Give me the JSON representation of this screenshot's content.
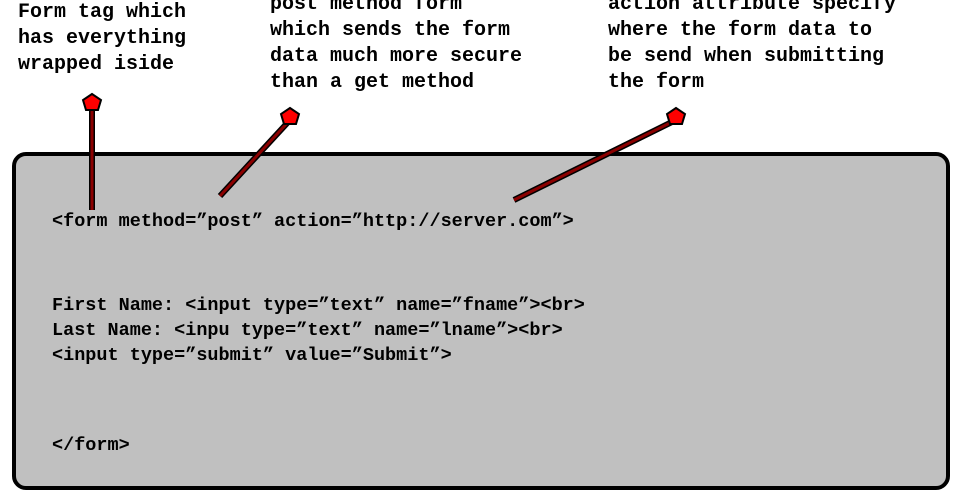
{
  "annotations": {
    "form_tag": "Form tag which\nhas everything\nwrapped iside",
    "post_method": "post method form\nwhich sends the form\ndata much more secure\nthan a get method",
    "action_attribute": "action attribute specify\nwhere the form data to\nbe send when submitting\nthe form"
  },
  "code": {
    "form_open": "<form method=”post” action=”http://server.com”>",
    "first_name_line": "First Name: <input type=”text” name=”fname”><br>",
    "last_name_line": "Last Name: <inpu type=”text” name=”lname”><br>",
    "submit_line": "<input type=”submit” value=”Submit”>",
    "form_close": "</form>"
  },
  "colors": {
    "code_background": "#c0c0c0",
    "callout_line": "#8b0000",
    "marker_fill": "#ff0000"
  }
}
